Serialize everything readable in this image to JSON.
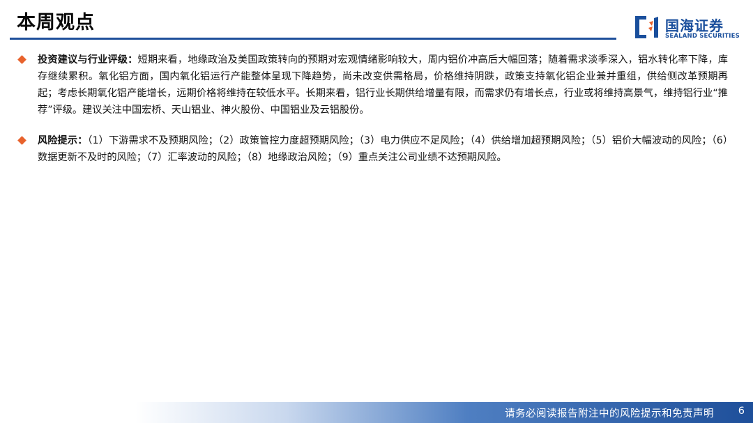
{
  "header": {
    "title": "本周观点",
    "logo": {
      "name_cn": "国海证券",
      "name_en": "SEALAND SECURITIES",
      "color": "#1a4f9c"
    }
  },
  "bullets": [
    {
      "heading": "投资建议与行业评级：",
      "text": "短期来看，地缘政治及美国政策转向的预期对宏观情绪影响较大，周内铝价冲高后大幅回落；随着需求淡季深入，铝水转化率下降，库存继续累积。氧化铝方面，国内氧化铝运行产能整体呈现下降趋势，尚未改变供需格局，价格维持阴跌，政策支持氧化铝企业兼并重组，供给侧改革预期再起；考虑长期氧化铝产能增长，远期价格将维持在较低水平。长期来看，铝行业长期供给增量有限，而需求仍有增长点，行业或将维持高景气，维持铝行业“推荐”评级。建议关注中国宏桥、天山铝业、神火股份、中国铝业及云铝股份。"
    },
    {
      "heading": "风险提示：",
      "text": "（1）下游需求不及预期风险；（2）政策管控力度超预期风险；（3）电力供应不足风险；（4）供给增加超预期风险；（5）铝价大幅波动的风险；（6）数据更新不及时的风险；（7）汇率波动的风险；（8）地缘政治风险；（9）重点关注公司业绩不达预期风险。"
    }
  ],
  "footer": {
    "disclaimer": "请务必阅读报告附注中的风险提示和免责声明",
    "page_number": "6"
  },
  "colors": {
    "accent_blue": "#1e4f9a",
    "bullet_orange": "#e8622c"
  }
}
